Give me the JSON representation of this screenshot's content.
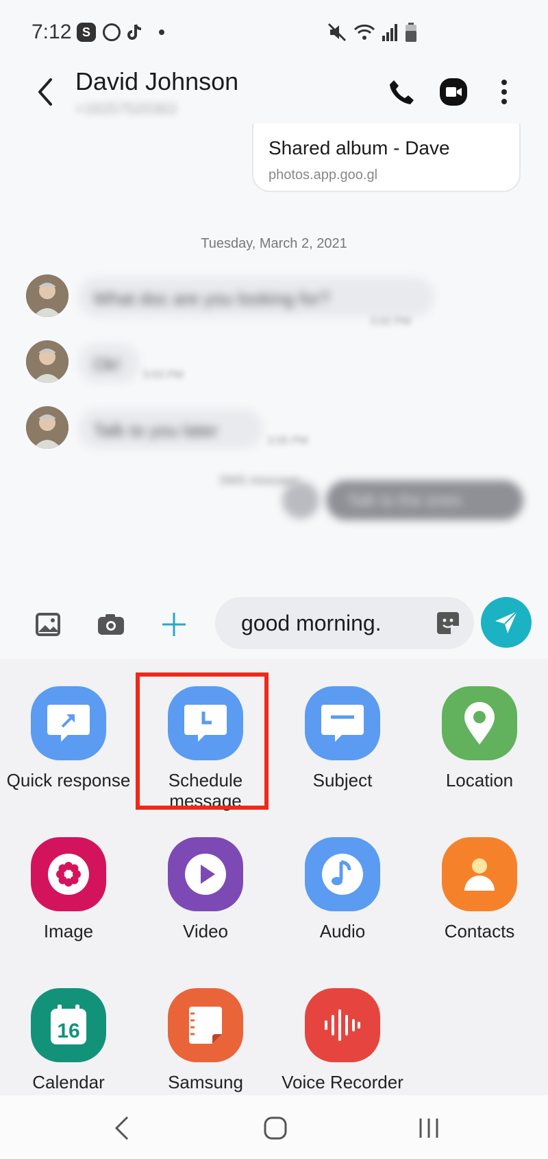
{
  "status": {
    "time": "7:12"
  },
  "header": {
    "contact_name": "David Johnson",
    "contact_number": "+16257520363"
  },
  "conversation": {
    "link_card": {
      "title": "Shared album - Dave",
      "url": "photos.app.goo.gl"
    },
    "date_separator": "Tuesday, March 2, 2021",
    "messages": [
      {
        "text": "What doc are you looking for?",
        "time": "3:02 PM"
      },
      {
        "text": "Ok!",
        "time": "3:03 PM"
      },
      {
        "text": "Talk to you later",
        "time": "3:05 PM"
      }
    ],
    "sms_label": "SMS message",
    "outgoing_preview": "Talk to the ones"
  },
  "composer": {
    "input_value": "good morning."
  },
  "attachments": [
    {
      "label": "Quick response",
      "icon": "quick-response-icon",
      "color": "#5b9bf2"
    },
    {
      "label": "Schedule message",
      "icon": "schedule-icon",
      "color": "#5b9bf2"
    },
    {
      "label": "Subject",
      "icon": "subject-icon",
      "color": "#5b9bf2"
    },
    {
      "label": "Location",
      "icon": "location-icon",
      "color": "#62b15d"
    },
    {
      "label": "Image",
      "icon": "image-flower-icon",
      "color": "#d3145d"
    },
    {
      "label": "Video",
      "icon": "video-play-icon",
      "color": "#7d4ab5"
    },
    {
      "label": "Audio",
      "icon": "music-note-icon",
      "color": "#5b9bf2"
    },
    {
      "label": "Contacts",
      "icon": "contact-person-icon",
      "color": "#f5822a"
    },
    {
      "label": "Calendar",
      "icon": "calendar-icon",
      "color": "#13927a",
      "day": "16"
    },
    {
      "label": "Samsung",
      "icon": "samsung-notes-icon",
      "color": "#ea6439"
    },
    {
      "label": "Voice Recorder",
      "icon": "voice-recorder-icon",
      "color": "#e6453f"
    }
  ],
  "highlight_color": "#f02818"
}
